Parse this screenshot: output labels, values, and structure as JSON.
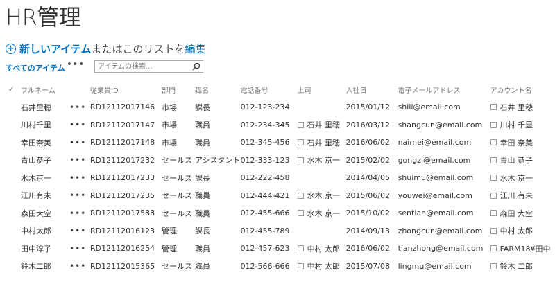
{
  "page": {
    "title": "HR管理"
  },
  "new_item": {
    "new_label": "新しいアイテム",
    "middle_text": "またはこのリストを",
    "edit_label": "編集"
  },
  "view": {
    "all_items": "すべてのアイテム",
    "more": "•••"
  },
  "search": {
    "placeholder": "アイテムの検索..."
  },
  "columns": {
    "check": "✓",
    "fullname": "フルネーム",
    "employee_id": "従業員ID",
    "department": "部門",
    "job_title": "職名",
    "phone": "電話番号",
    "manager": "上司",
    "hire_date": "入社日",
    "email": "電子メールアドレス",
    "account": "アカウント名"
  },
  "rows": [
    {
      "name": "石井里穂",
      "id": "RD12112017146",
      "dept": "市場",
      "title": "課長",
      "phone": "012-123-234",
      "manager": "",
      "date": "2015/01/12",
      "email": "shili@email.com",
      "account": "石井 里穂"
    },
    {
      "name": "川村千里",
      "id": "RD12112017147",
      "dept": "市場",
      "title": "職員",
      "phone": "012-234-345",
      "manager": "石井 里穂",
      "date": "2016/03/12",
      "email": "shangcun@email.com",
      "account": "川村 千里"
    },
    {
      "name": "幸田奈美",
      "id": "RD12112017148",
      "dept": "市場",
      "title": "職員",
      "phone": "012-345-456",
      "manager": "石井 里穂",
      "date": "2016/06/02",
      "email": "naimei@email.com",
      "account": "幸田 奈美"
    },
    {
      "name": "青山恭子",
      "id": "RD12112017232",
      "dept": "セールス",
      "title": "アシスタント",
      "phone": "012-333-123",
      "manager": "水木 京一",
      "date": "2015/02/02",
      "email": "gongzi@email.com",
      "account": "青山 恭子"
    },
    {
      "name": "水木京一",
      "id": "RD12112017233",
      "dept": "セールス",
      "title": "課長",
      "phone": "012-222-458",
      "manager": "",
      "date": "2014/04/05",
      "email": "shuimu@email.com",
      "account": "水木 京一"
    },
    {
      "name": "江川有未",
      "id": "RD12112017235",
      "dept": "セールス",
      "title": "職員",
      "phone": "012-444-421",
      "manager": "水木 京一",
      "date": "2015/06/02",
      "email": "youwei@email.com",
      "account": "江川 有未"
    },
    {
      "name": "森田大空",
      "id": "RD12112017588",
      "dept": "セールス",
      "title": "職員",
      "phone": "012-455-666",
      "manager": "水木 京一",
      "date": "2015/10/02",
      "email": "sentian@email.com",
      "account": "森田 大空"
    },
    {
      "name": "中村太郎",
      "id": "RD12112016123",
      "dept": "管理",
      "title": "課長",
      "phone": "012-455-789",
      "manager": "",
      "date": "2014/09/13",
      "email": "zhongcun@email.com",
      "account": "中村 太郎"
    },
    {
      "name": "田中淳子",
      "id": "RD12112016254",
      "dept": "管理",
      "title": "職員",
      "phone": "012-457-623",
      "manager": "中村 太郎",
      "date": "2016/06/02",
      "email": "tianzhong@email.com",
      "account": "FARM18¥田中"
    },
    {
      "name": "鈴木二郎",
      "id": "RD12112015365",
      "dept": "セールス",
      "title": "職員",
      "phone": "012-566-666",
      "manager": "中村 太郎",
      "date": "2015/07/08",
      "email": "lingmu@email.com",
      "account": "鈴木 二郎"
    }
  ],
  "colors": {
    "accent": "#0072c6",
    "text": "#333333",
    "header": "#777777"
  },
  "icons": {
    "new": "plus-circle-icon",
    "search": "search-icon",
    "menu": "ellipsis-icon",
    "user": "presence-icon"
  }
}
